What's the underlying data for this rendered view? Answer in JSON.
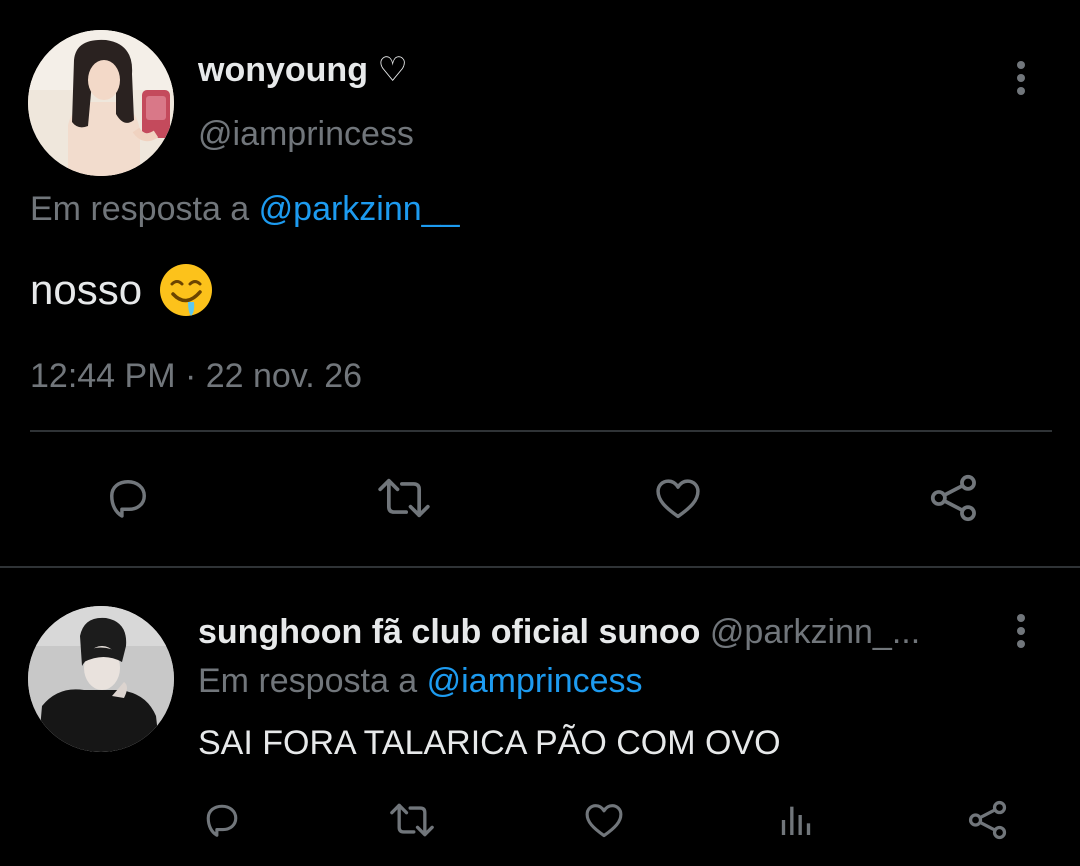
{
  "main_tweet": {
    "display_name": "wonyoung ♡",
    "handle": "@iamprincess",
    "reply_prefix": "Em resposta a ",
    "reply_mention": "@parkzinn__",
    "text": "nosso",
    "emoji": "drooling-face",
    "time": "12:44 PM",
    "separator": " · ",
    "date": "22 nov. 26",
    "actions": [
      "reply",
      "retweet",
      "like",
      "share"
    ]
  },
  "reply_tweet": {
    "display_name": "sunghoon fã club oficial sunoo",
    "handle": "@parkzinn_...",
    "reply_prefix": "Em resposta a ",
    "reply_mention": "@iamprincess",
    "text": "SAI FORA TALARICA PÃO COM OVO",
    "actions": [
      "reply",
      "retweet",
      "like",
      "views",
      "share"
    ]
  },
  "colors": {
    "background": "#000000",
    "primary_text": "#e7e9ea",
    "secondary_text": "#71767b",
    "accent": "#1d9bf0",
    "divider": "#2f3336"
  }
}
